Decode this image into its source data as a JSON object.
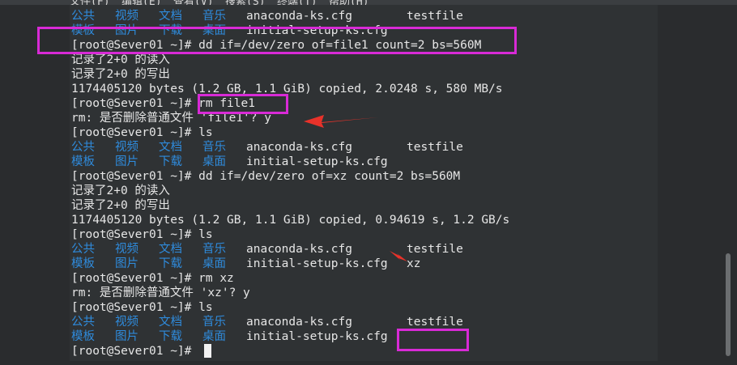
{
  "menubar": {
    "items": [
      "文件(F)",
      "编辑(E)",
      "查看(V)",
      "搜索(S)",
      "终端(T)",
      "帮助(H)"
    ]
  },
  "terminal": {
    "lines": [
      {
        "cols": [
          [
            "公共",
            "blue"
          ],
          [
            "视频",
            "blue"
          ],
          [
            "文档",
            "blue"
          ],
          [
            "音乐",
            "blue"
          ],
          [
            "anaconda-ks.cfg",
            "white"
          ],
          [
            "testfile",
            "white"
          ]
        ]
      },
      {
        "cols": [
          [
            "模板",
            "blue"
          ],
          [
            "图片",
            "blue"
          ],
          [
            "下载",
            "blue"
          ],
          [
            "桌面",
            "blue"
          ],
          [
            "initial-setup-ks.cfg",
            "white"
          ]
        ]
      },
      {
        "text": "[root@Sever01 ~]# dd if=/dev/zero of=file1 count=2 bs=560M"
      },
      {
        "text": "记录了2+0 的读入"
      },
      {
        "text": "记录了2+0 的写出"
      },
      {
        "text": "1174405120 bytes (1.2 GB, 1.1 GiB) copied, 2.0248 s, 580 MB/s"
      },
      {
        "text": "[root@Sever01 ~]# rm file1"
      },
      {
        "text": "rm: 是否删除普通文件 'file1'? y"
      },
      {
        "text": "[root@Sever01 ~]# ls"
      },
      {
        "cols": [
          [
            "公共",
            "blue"
          ],
          [
            "视频",
            "blue"
          ],
          [
            "文档",
            "blue"
          ],
          [
            "音乐",
            "blue"
          ],
          [
            "anaconda-ks.cfg",
            "white"
          ],
          [
            "testfile",
            "white"
          ]
        ]
      },
      {
        "cols": [
          [
            "模板",
            "blue"
          ],
          [
            "图片",
            "blue"
          ],
          [
            "下载",
            "blue"
          ],
          [
            "桌面",
            "blue"
          ],
          [
            "initial-setup-ks.cfg",
            "white"
          ]
        ]
      },
      {
        "text": "[root@Sever01 ~]# dd if=/dev/zero of=xz count=2 bs=560M"
      },
      {
        "text": "记录了2+0 的读入"
      },
      {
        "text": "记录了2+0 的写出"
      },
      {
        "text": "1174405120 bytes (1.2 GB, 1.1 GiB) copied, 0.94619 s, 1.2 GB/s"
      },
      {
        "text": "[root@Sever01 ~]# ls"
      },
      {
        "cols": [
          [
            "公共",
            "blue"
          ],
          [
            "视频",
            "blue"
          ],
          [
            "文档",
            "blue"
          ],
          [
            "音乐",
            "blue"
          ],
          [
            "anaconda-ks.cfg",
            "white"
          ],
          [
            "testfile",
            "white"
          ]
        ]
      },
      {
        "cols": [
          [
            "模板",
            "blue"
          ],
          [
            "图片",
            "blue"
          ],
          [
            "下载",
            "blue"
          ],
          [
            "桌面",
            "blue"
          ],
          [
            "initial-setup-ks.cfg",
            "white"
          ],
          [
            "xz",
            "white"
          ]
        ]
      },
      {
        "text": "[root@Sever01 ~]# rm xz"
      },
      {
        "text": "rm: 是否删除普通文件 'xz'? y"
      },
      {
        "text": "[root@Sever01 ~]# ls"
      },
      {
        "cols": [
          [
            "公共",
            "blue"
          ],
          [
            "视频",
            "blue"
          ],
          [
            "文档",
            "blue"
          ],
          [
            "音乐",
            "blue"
          ],
          [
            "anaconda-ks.cfg",
            "white"
          ],
          [
            "testfile",
            "white"
          ]
        ]
      },
      {
        "cols": [
          [
            "模板",
            "blue"
          ],
          [
            "图片",
            "blue"
          ],
          [
            "下载",
            "blue"
          ],
          [
            "桌面",
            "blue"
          ],
          [
            "initial-setup-ks.cfg",
            "white"
          ]
        ]
      },
      {
        "text": "[root@Sever01 ~]# "
      }
    ]
  },
  "colors": {
    "terminal_bg": "#2f3234",
    "directory_blue": "#2f8bdc",
    "text": "#e6e6e6",
    "annotation_box": "#d82ad6",
    "annotation_arrow": "#e8322a"
  }
}
